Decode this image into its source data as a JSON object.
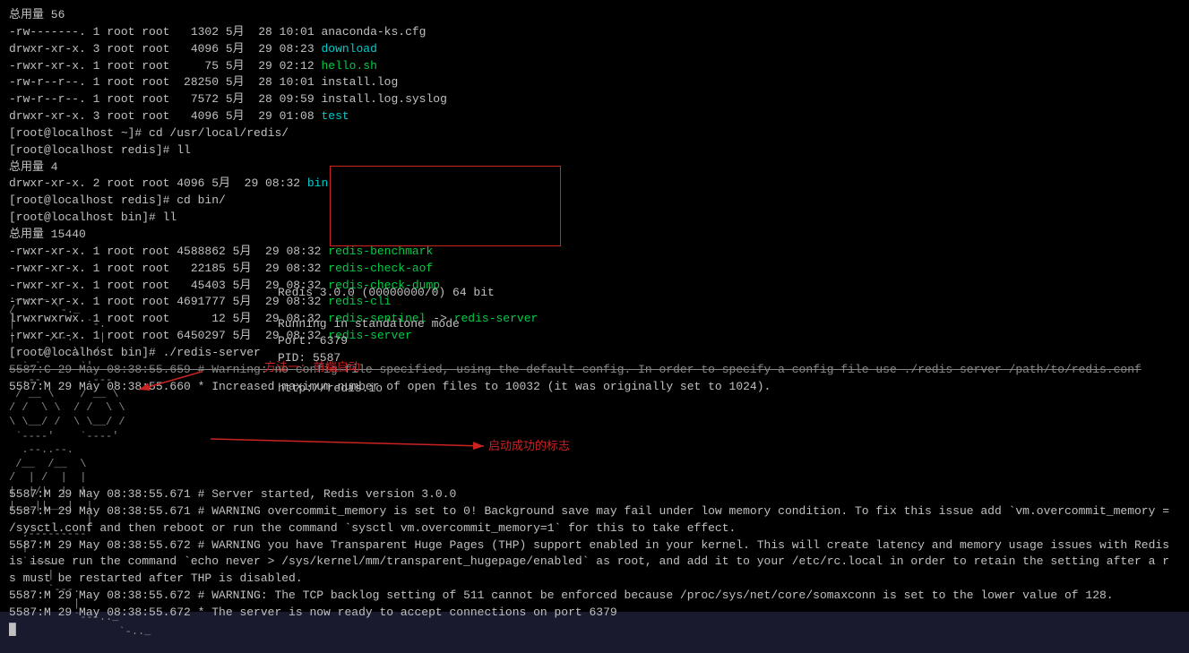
{
  "terminal": {
    "lines": [
      {
        "id": 1,
        "text": "总用量 56",
        "color": "white"
      },
      {
        "id": 2,
        "text": "-rw-------. 1 root root   1302 5月  28 10:01 anaconda-ks.cfg",
        "color": "white"
      },
      {
        "id": 3,
        "text": "drwxr-xr-x. 3 root root   4096 5月  29 08:23 ",
        "color": "white",
        "link": "download",
        "linkColor": "cyan"
      },
      {
        "id": 4,
        "text": "-rwxr-xr-x. 1 root root     75 5月  29 02:12 ",
        "color": "white",
        "link": "hello.sh",
        "linkColor": "green"
      },
      {
        "id": 5,
        "text": "-rw-r--r--. 1 root root  28250 5月  28 10:01 install.log",
        "color": "white"
      },
      {
        "id": 6,
        "text": "-rw-r--r--. 1 root root   7572 5月  28 09:59 install.log.syslog",
        "color": "white"
      },
      {
        "id": 7,
        "text": "drwxr-xr-x. 3 root root   4096 5月  29 01:08 ",
        "color": "white",
        "link": "test",
        "linkColor": "cyan"
      },
      {
        "id": 8,
        "text": "[root@localhost ~]# cd /usr/local/redis/",
        "color": "white"
      },
      {
        "id": 9,
        "text": "[root@localhost redis]# ll",
        "color": "white"
      },
      {
        "id": 10,
        "text": "总用量 4",
        "color": "white"
      },
      {
        "id": 11,
        "text": "drwxr-xr-x. 2 root root 4096 5月  29 08:32 ",
        "color": "white",
        "link": "bin",
        "linkColor": "cyan"
      },
      {
        "id": 12,
        "text": "[root@localhost redis]# cd bin/",
        "color": "white"
      },
      {
        "id": 13,
        "text": "[root@localhost bin]# ll",
        "color": "white"
      },
      {
        "id": 14,
        "text": "总用量 15440",
        "color": "white"
      },
      {
        "id": 15,
        "text": "-rwxr-xr-x. 1 root root 4588862 5月  29 08:32 ",
        "color": "white",
        "link": "redis-benchmark",
        "linkColor": "green"
      },
      {
        "id": 16,
        "text": "-rwxr-xr-x. 1 root root   22185 5月  29 08:32 ",
        "color": "white",
        "link": "redis-check-aof",
        "linkColor": "green"
      },
      {
        "id": 17,
        "text": "-rwxr-xr-x. 1 root root   45403 5月  29 08:32 ",
        "color": "white",
        "link": "redis-check-dump",
        "linkColor": "green"
      },
      {
        "id": 18,
        "text": "-rwxr-xr-x. 1 root root 4691777 5月  29 08:32 ",
        "color": "white",
        "link": "redis-cli",
        "linkColor": "green"
      },
      {
        "id": 19,
        "text": "lrwxrwxrwx. 1 root root      12 5月  29 08:32 ",
        "color": "white",
        "link": "redis-sentinel",
        "linkColor": "green",
        "arrow": " -> ",
        "link2": "redis-server",
        "link2Color": "green"
      },
      {
        "id": 20,
        "text": "-rwxr-xr-x. 1 root root 6450297 5月  29 08:32 ",
        "color": "white",
        "link": "redis-server",
        "linkColor": "green"
      },
      {
        "id": 21,
        "text": "[root@localhost bin]# ./redis-server",
        "color": "white"
      },
      {
        "id": 22,
        "text": "5587:C 29 May 08:38:55.659 # Warning: no config file specified, using the default config. In order to specify a config file use ./redis-server /path/to/redis.conf",
        "color": "white",
        "strikeColor": true
      },
      {
        "id": 23,
        "text": "5587:M 29 May 08:38:55.660 * Increased maximum number of open files to 10032 (it was originally set to 1024).",
        "color": "white"
      }
    ],
    "server_info": {
      "version": "Redis 3.0.0 (00000000/0) 64 bit",
      "mode": "Running in standalone mode",
      "port": "Port: 6379",
      "pid": "PID: 5587",
      "url": "http://redis.io"
    },
    "warnings": [
      "5587:M 29 May 08:38:55.671 # Server started, Redis version 3.0.0",
      "5587:M 29 May 08:38:55.671 # WARNING overcommit_memory is set to 0! Background save may fail under low memory condition. To fix this issue add 'vm.overcommit_memory =",
      "/sysctl.conf and then reboot or run the command 'sysctl vm.overcommit_memory=1' for this to take effect.",
      "5587:M 29 May 08:38:55.672 # WARNING you have Transparent Huge Pages (THP) support enabled in your kernel. This will create latency and memory usage issues with Redis",
      "is issue run the command 'echo never > /sys/kernel/mm/transparent_hugepage/enabled' as root, and add it to your /etc/rc.local in order to retain the setting after a r",
      "s must be restarted after THP is disabled.",
      "5587:M 29 May 08:38:55.672 # WARNING: The TCP backlog setting of 511 cannot be enforced because /proc/sys/net/core/somaxconn is set to the lower value of 128.",
      "5587:M 29 May 08:38:55.672 * The server is now ready to accept connections on port 6379"
    ],
    "annotation1": "方法一: 前端启动",
    "annotation2": "启动成功的标志"
  }
}
